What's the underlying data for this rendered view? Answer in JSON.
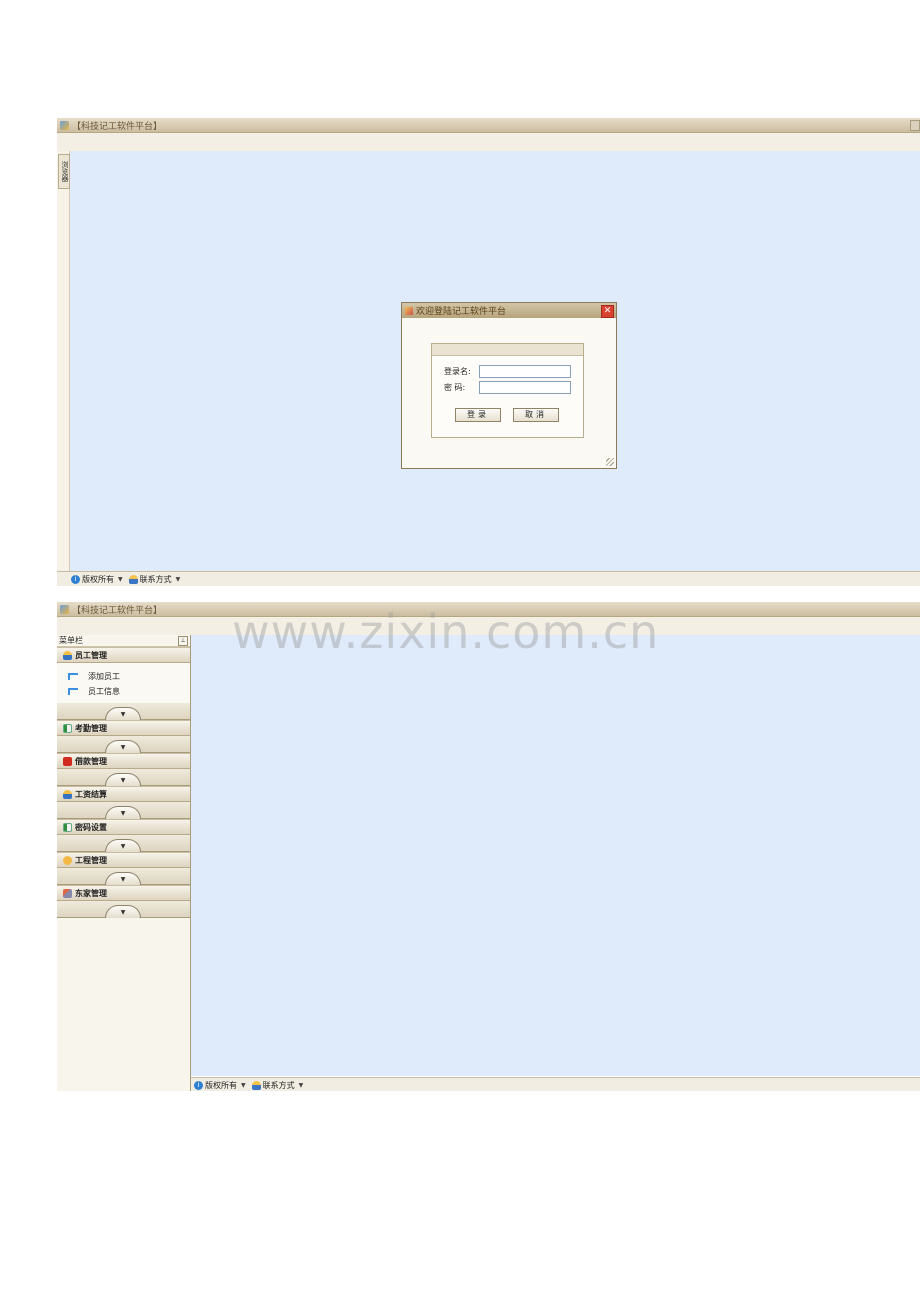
{
  "window_title": "【科技记工软件平台】",
  "screen1": {
    "side_tab_label": "浏览器",
    "login": {
      "title": "欢迎登陆记工软件平台",
      "close_glyph": "✕",
      "username_label": "登录名:",
      "password_label": "密  码:",
      "username_value": "",
      "password_value": "",
      "login_button": "登录",
      "cancel_button": "取消"
    },
    "status": {
      "copyright": "版权所有",
      "contact": "联系方式"
    }
  },
  "screen2": {
    "sidebar_title": "菜单栏",
    "pin_glyph": "⊥",
    "sections": [
      {
        "label": "员工管理",
        "icon": "person-icon",
        "items": [
          "添加员工",
          "员工信息"
        ]
      },
      {
        "label": "考勤管理",
        "icon": "board-icon"
      },
      {
        "label": "借款管理",
        "icon": "book-icon"
      },
      {
        "label": "工资结算",
        "icon": "person-icon"
      },
      {
        "label": "密码设置",
        "icon": "board-icon"
      },
      {
        "label": "工程管理",
        "icon": "hand-icon"
      },
      {
        "label": "东家管理",
        "icon": "tool-icon"
      }
    ],
    "expand_glyph": "▼",
    "status": {
      "copyright": "版权所有",
      "contact": "联系方式"
    }
  },
  "watermark": "www.zixin.com.cn",
  "colors": {
    "client_bg": "#dfeafb",
    "titlebar": "#cbbd9f",
    "close": "#d84030"
  }
}
